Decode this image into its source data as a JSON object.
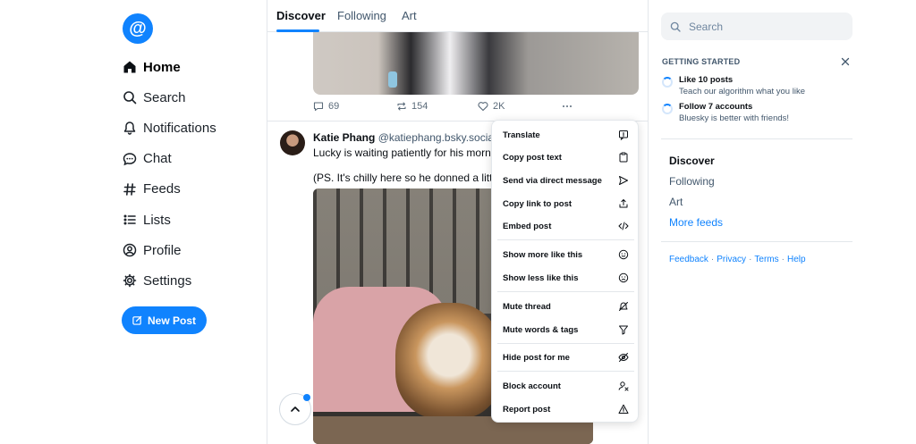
{
  "app": {
    "logo_glyph": "@",
    "colors": {
      "accent": "#1083fe",
      "text": "#0b0f14",
      "muted": "#42576c",
      "border": "#e3e7eb"
    }
  },
  "nav": {
    "items": [
      {
        "label": "Home",
        "icon": "home-icon",
        "active": true
      },
      {
        "label": "Search",
        "icon": "search-icon"
      },
      {
        "label": "Notifications",
        "icon": "bell-icon"
      },
      {
        "label": "Chat",
        "icon": "chat-icon"
      },
      {
        "label": "Feeds",
        "icon": "hash-icon"
      },
      {
        "label": "Lists",
        "icon": "list-icon"
      },
      {
        "label": "Profile",
        "icon": "profile-icon"
      },
      {
        "label": "Settings",
        "icon": "gear-icon"
      }
    ],
    "new_post_label": "New Post"
  },
  "tabs": [
    {
      "label": "Discover",
      "active": true
    },
    {
      "label": "Following"
    },
    {
      "label": "Art"
    }
  ],
  "post1": {
    "replies": "69",
    "reposts": "154",
    "likes": "2K"
  },
  "post2": {
    "author": "Katie Phang",
    "handle": "@katiephang.bsky.social · 3",
    "line1": "Lucky is waiting patiently for his morning",
    "line2": "(PS. It's chilly here so he donned a little j"
  },
  "menu": {
    "items": [
      {
        "label": "Translate",
        "icon": "translate-icon"
      },
      {
        "label": "Copy post text",
        "icon": "clipboard-icon"
      },
      {
        "label": "Send via direct message",
        "icon": "send-icon"
      },
      {
        "label": "Copy link to post",
        "icon": "share-icon"
      },
      {
        "label": "Embed post",
        "icon": "code-icon"
      },
      {
        "label": "Show more like this",
        "icon": "smile-icon"
      },
      {
        "label": "Show less like this",
        "icon": "frown-icon"
      },
      {
        "label": "Mute thread",
        "icon": "mute-icon"
      },
      {
        "label": "Mute words & tags",
        "icon": "filter-icon"
      },
      {
        "label": "Hide post for me",
        "icon": "eye-off-icon"
      },
      {
        "label": "Block account",
        "icon": "block-user-icon"
      },
      {
        "label": "Report post",
        "icon": "warning-icon"
      }
    ]
  },
  "right": {
    "search_placeholder": "Search",
    "getting_started_title": "GETTING STARTED",
    "tasks": [
      {
        "title": "Like 10 posts",
        "subtitle": "Teach our algorithm what you like"
      },
      {
        "title": "Follow 7 accounts",
        "subtitle": "Bluesky is better with friends!"
      }
    ],
    "feeds": [
      {
        "label": "Discover"
      },
      {
        "label": "Following"
      },
      {
        "label": "Art"
      },
      {
        "label": "More feeds"
      }
    ],
    "footer": {
      "feedback": "Feedback",
      "privacy": "Privacy",
      "terms": "Terms",
      "help": "Help"
    }
  }
}
